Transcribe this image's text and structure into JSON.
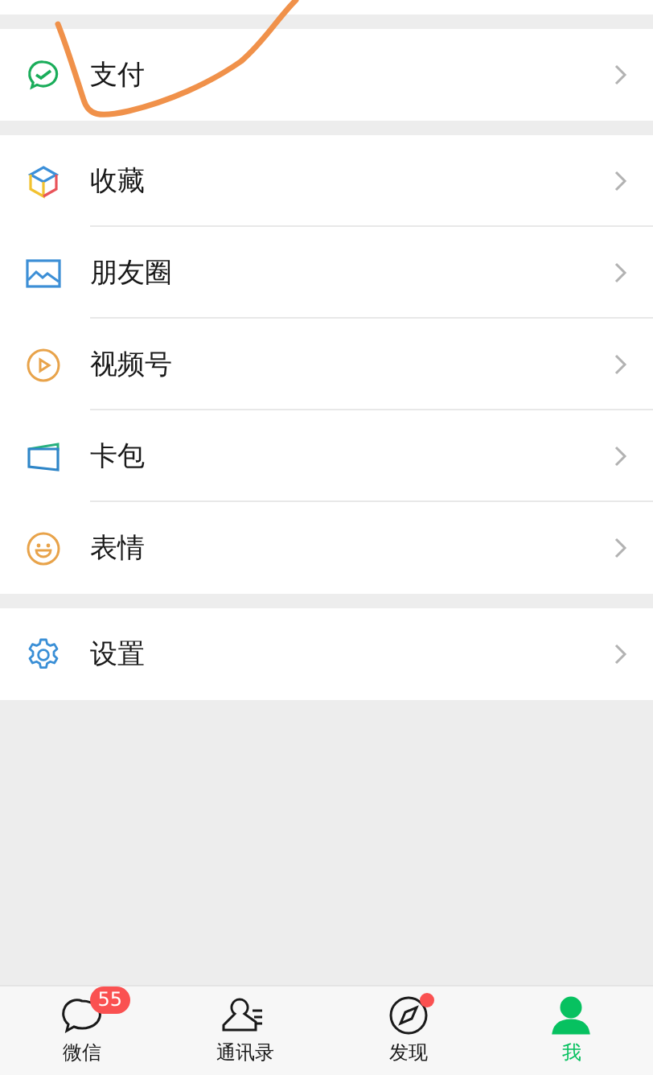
{
  "sections": [
    {
      "items": [
        {
          "kind": "pay",
          "label": "支付"
        }
      ]
    },
    {
      "items": [
        {
          "kind": "favorites",
          "label": "收藏"
        },
        {
          "kind": "moments",
          "label": "朋友圈"
        },
        {
          "kind": "channels",
          "label": "视频号"
        },
        {
          "kind": "cards",
          "label": "卡包"
        },
        {
          "kind": "stickers",
          "label": "表情"
        }
      ]
    },
    {
      "items": [
        {
          "kind": "settings",
          "label": "设置"
        }
      ]
    }
  ],
  "tab_bar": [
    {
      "kind": "chat",
      "label": "微信",
      "badge": "55",
      "dot": false,
      "selected": false
    },
    {
      "kind": "contacts",
      "label": "通讯录",
      "dot": false,
      "selected": false
    },
    {
      "kind": "discover",
      "label": "发现",
      "dot": true,
      "selected": false
    },
    {
      "kind": "me",
      "label": "我",
      "dot": false,
      "selected": true
    }
  ]
}
